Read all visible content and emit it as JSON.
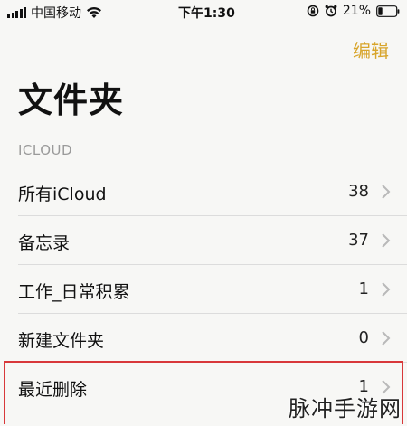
{
  "status_bar": {
    "carrier": "中国移动",
    "time": "下午1:30",
    "battery_percent": "21%",
    "icons": [
      "signal-icon",
      "wifi-icon",
      "orientation-lock-icon",
      "alarm-icon",
      "battery-icon"
    ]
  },
  "nav": {
    "edit_label": "编辑",
    "accent_color": "#d8a52b"
  },
  "page": {
    "title": "文件夹"
  },
  "section": {
    "header": "ICLOUD"
  },
  "folders": [
    {
      "label": "所有iCloud",
      "count": "38"
    },
    {
      "label": "备忘录",
      "count": "37"
    },
    {
      "label": "工作_日常积累",
      "count": "1"
    },
    {
      "label": "新建文件夹",
      "count": "0"
    },
    {
      "label": "最近删除",
      "count": "1"
    }
  ],
  "highlight": {
    "color": "#d8383a",
    "target": "最近删除"
  },
  "watermark": "脉冲手游网"
}
